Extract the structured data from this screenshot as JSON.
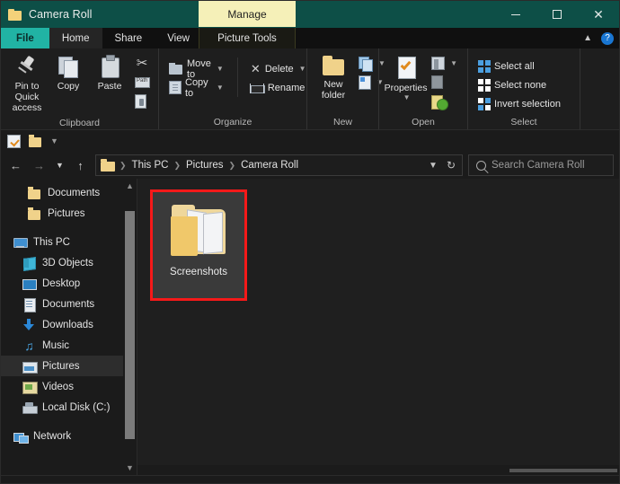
{
  "window": {
    "title": "Camera Roll",
    "title_icon": "folder-icon",
    "manage_tab": "Manage",
    "minimize": "minimize-icon",
    "maximize": "maximize-icon",
    "close": "close-icon"
  },
  "colors": {
    "titlebar": "#0d4f47",
    "file_tab": "#21b3a4",
    "manage_tab": "#f5f0b8",
    "selection_highlight": "#f51919",
    "folder_yellow": "#f0d28a",
    "accent_blue": "#4b9fe0"
  },
  "tabs": [
    {
      "label": "File",
      "id": "file"
    },
    {
      "label": "Home",
      "id": "home"
    },
    {
      "label": "Share",
      "id": "share"
    },
    {
      "label": "View",
      "id": "view"
    },
    {
      "label": "Picture Tools",
      "id": "picture-tools"
    }
  ],
  "tabbar_right": {
    "collapse_ribbon": "chevron-up-icon",
    "help": "?"
  },
  "ribbon": {
    "groups": [
      {
        "label": "Clipboard",
        "big_buttons": [
          {
            "label": "Pin to Quick\naccess",
            "line1": "Pin to Quick",
            "line2": "access",
            "icon": "pin-icon"
          },
          {
            "label": "Copy",
            "icon": "copy-icon"
          },
          {
            "label": "Paste",
            "icon": "paste-icon"
          }
        ],
        "small_buttons": [
          {
            "label": "",
            "icon": "cut-scissors-icon"
          },
          {
            "label": "",
            "icon": "copy-path-icon"
          },
          {
            "label": "",
            "icon": "paste-shortcut-icon"
          }
        ]
      },
      {
        "label": "Organize",
        "small_buttons": [
          {
            "label": "Move to",
            "icon": "move-to-icon",
            "has_caret": true
          },
          {
            "label": "Copy to",
            "icon": "copy-to-icon",
            "has_caret": true
          },
          {
            "label": "Delete",
            "icon": "delete-x-icon",
            "has_caret": true
          },
          {
            "label": "Rename",
            "icon": "rename-icon",
            "has_caret": false
          }
        ]
      },
      {
        "label": "New",
        "big_buttons": [
          {
            "line1": "New",
            "line2": "folder",
            "icon": "new-folder-icon"
          }
        ],
        "small_buttons": [
          {
            "label": "",
            "icon": "new-item-icon",
            "has_caret": true
          },
          {
            "label": "",
            "icon": "easy-access-icon",
            "has_caret": true
          }
        ]
      },
      {
        "label": "Open",
        "big_buttons": [
          {
            "line1": "Properties",
            "icon": "properties-icon",
            "has_caret": true
          }
        ],
        "small_buttons": [
          {
            "label": "",
            "icon": "open-icon",
            "has_caret": true
          },
          {
            "label": "",
            "icon": "edit-icon",
            "has_caret": false
          },
          {
            "label": "",
            "icon": "history-icon",
            "has_caret": false
          }
        ]
      },
      {
        "label": "Select",
        "small_buttons": [
          {
            "label": "Select all",
            "icon": "select-all-icon"
          },
          {
            "label": "Select none",
            "icon": "select-none-icon"
          },
          {
            "label": "Invert selection",
            "icon": "invert-selection-icon"
          }
        ]
      }
    ]
  },
  "quick_access": {
    "items": [
      {
        "icon": "properties-qat-icon"
      },
      {
        "icon": "new-folder-qat-icon"
      },
      {
        "icon": "customize-caret-icon"
      }
    ]
  },
  "address_bar": {
    "back": "back-arrow-icon",
    "forward": "forward-arrow-icon",
    "recent": "recent-locations-icon",
    "up": "up-arrow-icon",
    "path_icon": "folder-icon",
    "crumbs": [
      "This PC",
      "Pictures",
      "Camera Roll"
    ],
    "dropdown": "chevron-down-icon",
    "refresh": "refresh-icon"
  },
  "search": {
    "icon": "search-icon",
    "placeholder": "Search Camera Roll",
    "value": ""
  },
  "nav_pane": {
    "items": [
      {
        "label": "Documents",
        "icon": "folder-icon",
        "level": 2,
        "selected": false
      },
      {
        "label": "Pictures",
        "icon": "folder-icon",
        "level": 2,
        "selected": false
      },
      {
        "gap": true
      },
      {
        "label": "This PC",
        "icon": "this-pc-icon",
        "level": 1,
        "selected": false
      },
      {
        "label": "3D Objects",
        "icon": "3d-objects-icon",
        "level": 2,
        "selected": false
      },
      {
        "label": "Desktop",
        "icon": "desktop-icon",
        "level": 2,
        "selected": false
      },
      {
        "label": "Documents",
        "icon": "documents-icon",
        "level": 2,
        "selected": false
      },
      {
        "label": "Downloads",
        "icon": "downloads-icon",
        "level": 2,
        "selected": false
      },
      {
        "label": "Music",
        "icon": "music-icon",
        "level": 2,
        "selected": false
      },
      {
        "label": "Pictures",
        "icon": "pictures-icon",
        "level": 2,
        "selected": true
      },
      {
        "label": "Videos",
        "icon": "videos-icon",
        "level": 2,
        "selected": false
      },
      {
        "label": "Local Disk (C:)",
        "icon": "local-disk-icon",
        "level": 2,
        "selected": false
      },
      {
        "gap": true
      },
      {
        "label": "Network",
        "icon": "network-icon",
        "level": 1,
        "selected": false
      }
    ],
    "scroll_up": "scroll-up-icon",
    "scroll_down": "scroll-down-icon"
  },
  "content": {
    "items": [
      {
        "label": "Screenshots",
        "icon": "screenshots-folder-icon",
        "selected": true,
        "highlighted": true
      }
    ]
  }
}
